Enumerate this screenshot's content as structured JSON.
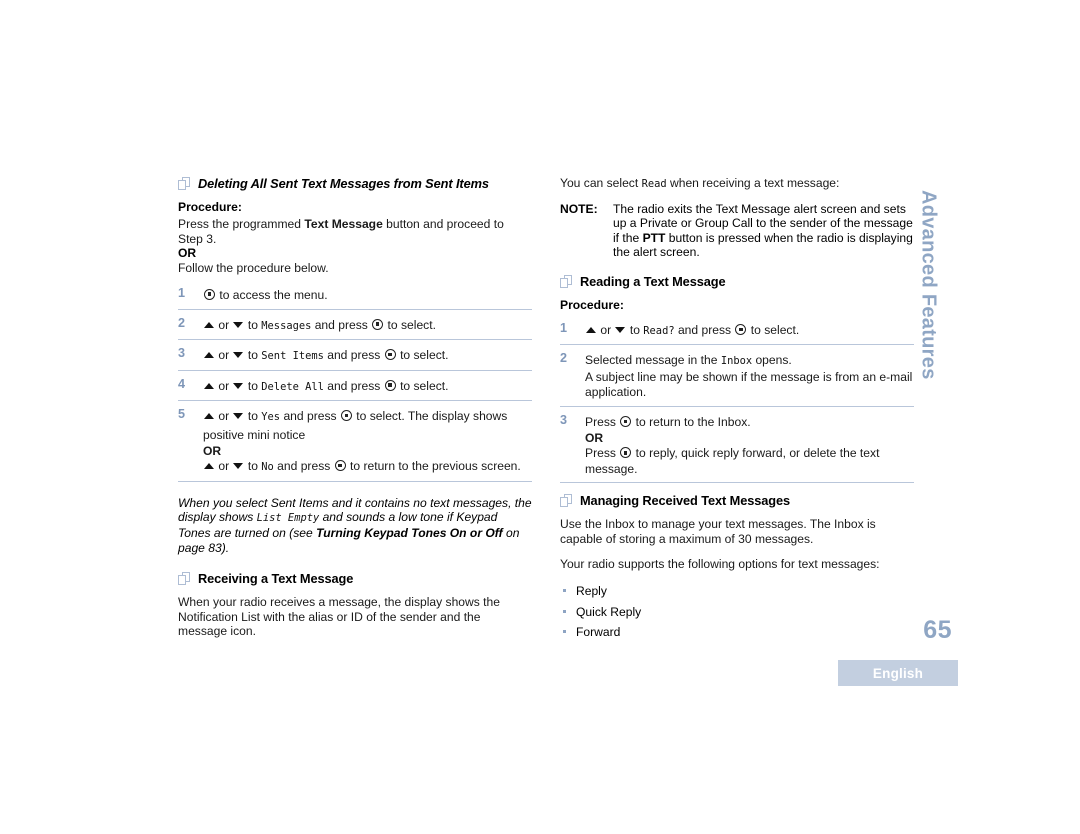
{
  "document": {
    "page_number": "65",
    "language_badge": "English",
    "side_tab": "Advanced Features",
    "colors": {
      "accent_blue_gray": "#8fa6c4",
      "rule_blue": "#b9c6da",
      "lang_bar_bg": "#c3cfe0",
      "step_number": "#7e96b8"
    }
  },
  "left_column": {
    "section1": {
      "heading": "Deleting All Sent Text Messages from Sent Items",
      "heading_icon": "pages-icon",
      "procedure_label": "Procedure:",
      "intro_before_bold": "Press the programmed ",
      "intro_bold": "Text Message",
      "intro_after_bold": " button and proceed to Step 3.",
      "or_label": "OR",
      "follow_text": "Follow the procedure below.",
      "steps": [
        {
          "num": "1",
          "icon_before": "menu-button-icon",
          "text": " to access the menu."
        },
        {
          "num": "2",
          "prefix_up": "up-arrow-icon",
          "or_word": " or ",
          "prefix_down": "down-arrow-icon",
          "text_a": " to ",
          "lcd": "Messages",
          "text_b": " and press ",
          "icon": "menu-button-icon",
          "text_c": " to select."
        },
        {
          "num": "3",
          "text_a": " to ",
          "lcd": "Sent Items",
          "text_b": " and press ",
          "text_c": " to select."
        },
        {
          "num": "4",
          "text_a": " to ",
          "lcd": "Delete All",
          "text_b": " and press ",
          "text_c": " to select."
        },
        {
          "num": "5",
          "text_a": " to ",
          "lcd": "Yes",
          "text_b": " and press ",
          "text_c": " to select. The display shows positive mini notice",
          "or_label": "OR",
          "alt_text_a": " to ",
          "alt_lcd": "No",
          "alt_text_b": " and press ",
          "alt_text_c": " to return to the previous screen."
        }
      ]
    },
    "italic_note": {
      "part1": "When you select Sent Items and it contains no text messages, the display shows ",
      "lcd": "List Empty",
      "part2": " and sounds a low tone if Keypad Tones are turned on (see ",
      "bold": "Turning Keypad Tones On or Off",
      "part3": " on page 83)."
    },
    "section2": {
      "heading": "Receiving a Text Message",
      "heading_icon": "pages-icon",
      "body": "When your radio receives a message, the display shows the Notification List with the alias or ID of the sender and the message icon."
    }
  },
  "right_column": {
    "intro": {
      "part1": "You can select ",
      "lcd": "Read",
      "part2": " when receiving a text message:"
    },
    "note": {
      "label": "NOTE:",
      "part1": "The radio exits the Text Message alert screen and sets up a Private or Group Call to the sender of the message if the ",
      "bold": "PTT",
      "part2": " button is pressed when the radio is displaying the alert screen."
    },
    "section1": {
      "heading": "Reading a Text Message",
      "heading_icon": "pages-icon",
      "procedure_label": "Procedure:",
      "steps": [
        {
          "num": "1",
          "text_a": " to ",
          "lcd": "Read?",
          "text_b": " and press ",
          "text_c": " to select."
        },
        {
          "num": "2",
          "text_a": "Selected message in the ",
          "lcd": "Inbox",
          "text_b": " opens.",
          "sub": "A subject line may be shown if the message is from an e-mail application."
        },
        {
          "num": "3",
          "text_a": "Press ",
          "text_b": " to return to the Inbox.",
          "or_label": "OR",
          "alt_text_a": "Press ",
          "alt_text_b": " to reply, quick reply forward, or delete the text message."
        }
      ]
    },
    "section2": {
      "heading": "Managing Received Text Messages",
      "heading_icon": "pages-icon",
      "body1": "Use the Inbox to manage your text messages. The Inbox is capable of storing a maximum of 30 messages.",
      "body2": "Your radio supports the following options for text messages:",
      "options": [
        "Reply",
        "Quick Reply",
        "Forward"
      ]
    }
  }
}
